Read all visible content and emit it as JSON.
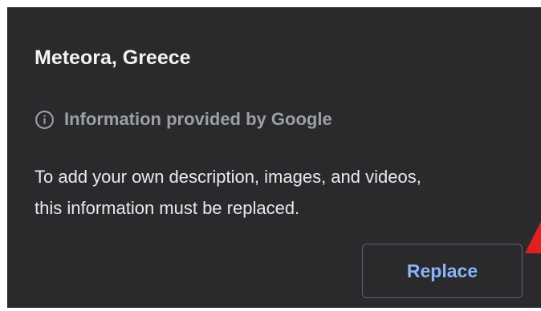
{
  "dialog": {
    "title": "Meteora, Greece",
    "info_icon": "info-circle-icon",
    "info_text": "Information provided by Google",
    "description_lines": [
      "To add your own description, images, and videos,",
      "this information must be replaced."
    ],
    "replace_label": "Replace"
  },
  "colors": {
    "panel_bg": "#2a2a2c",
    "title_text": "#f1f3f4",
    "info_text": "#9aa0a6",
    "body_text": "#e8eaed",
    "button_text": "#8ab4f8",
    "button_border": "#5f6368",
    "pointer_mark": "#e02020"
  }
}
